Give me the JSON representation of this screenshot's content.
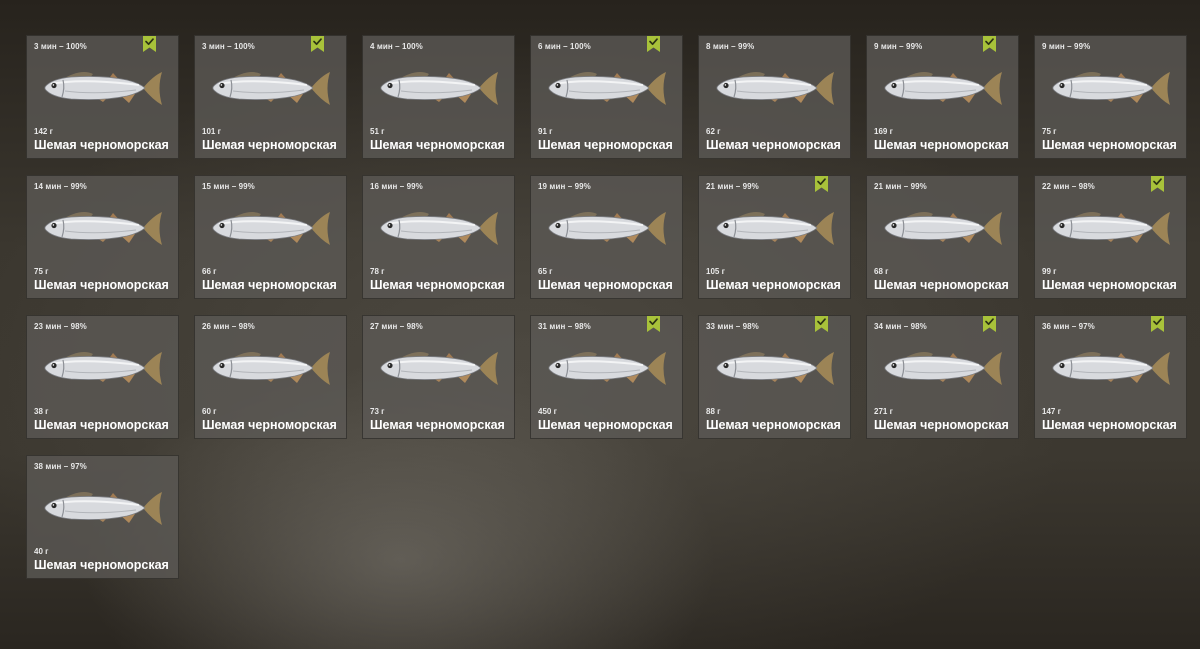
{
  "colors": {
    "accent": "#a8c23a",
    "card_background": "#5c5a56",
    "text": "#ffffff"
  },
  "catches": [
    {
      "time_quality": "3 мин – 100%",
      "weight": "142 г",
      "name": "Шемая черноморская",
      "marked": true
    },
    {
      "time_quality": "3 мин – 100%",
      "weight": "101 г",
      "name": "Шемая черноморская",
      "marked": true
    },
    {
      "time_quality": "4 мин – 100%",
      "weight": "51 г",
      "name": "Шемая черноморская",
      "marked": false
    },
    {
      "time_quality": "6 мин – 100%",
      "weight": "91 г",
      "name": "Шемая черноморская",
      "marked": true
    },
    {
      "time_quality": "8 мин – 99%",
      "weight": "62 г",
      "name": "Шемая черноморская",
      "marked": false
    },
    {
      "time_quality": "9 мин – 99%",
      "weight": "169 г",
      "name": "Шемая черноморская",
      "marked": true
    },
    {
      "time_quality": "9 мин – 99%",
      "weight": "75 г",
      "name": "Шемая черноморская",
      "marked": false
    },
    {
      "time_quality": "14 мин – 99%",
      "weight": "75 г",
      "name": "Шемая черноморская",
      "marked": false
    },
    {
      "time_quality": "15 мин – 99%",
      "weight": "66 г",
      "name": "Шемая черноморская",
      "marked": false
    },
    {
      "time_quality": "16 мин – 99%",
      "weight": "78 г",
      "name": "Шемая черноморская",
      "marked": false
    },
    {
      "time_quality": "19 мин – 99%",
      "weight": "65 г",
      "name": "Шемая черноморская",
      "marked": false
    },
    {
      "time_quality": "21 мин – 99%",
      "weight": "105 г",
      "name": "Шемая черноморская",
      "marked": true
    },
    {
      "time_quality": "21 мин – 99%",
      "weight": "68 г",
      "name": "Шемая черноморская",
      "marked": false
    },
    {
      "time_quality": "22 мин – 98%",
      "weight": "99 г",
      "name": "Шемая черноморская",
      "marked": true
    },
    {
      "time_quality": "23 мин – 98%",
      "weight": "38 г",
      "name": "Шемая черноморская",
      "marked": false
    },
    {
      "time_quality": "26 мин – 98%",
      "weight": "60 г",
      "name": "Шемая черноморская",
      "marked": false
    },
    {
      "time_quality": "27 мин – 98%",
      "weight": "73 г",
      "name": "Шемая черноморская",
      "marked": false
    },
    {
      "time_quality": "31 мин – 98%",
      "weight": "450 г",
      "name": "Шемая черноморская",
      "marked": true
    },
    {
      "time_quality": "33 мин – 98%",
      "weight": "88 г",
      "name": "Шемая черноморская",
      "marked": true
    },
    {
      "time_quality": "34 мин – 98%",
      "weight": "271 г",
      "name": "Шемая черноморская",
      "marked": true
    },
    {
      "time_quality": "36 мин – 97%",
      "weight": "147 г",
      "name": "Шемая черноморская",
      "marked": true
    },
    {
      "time_quality": "38 мин – 97%",
      "weight": "40 г",
      "name": "Шемая черноморская",
      "marked": false
    }
  ]
}
